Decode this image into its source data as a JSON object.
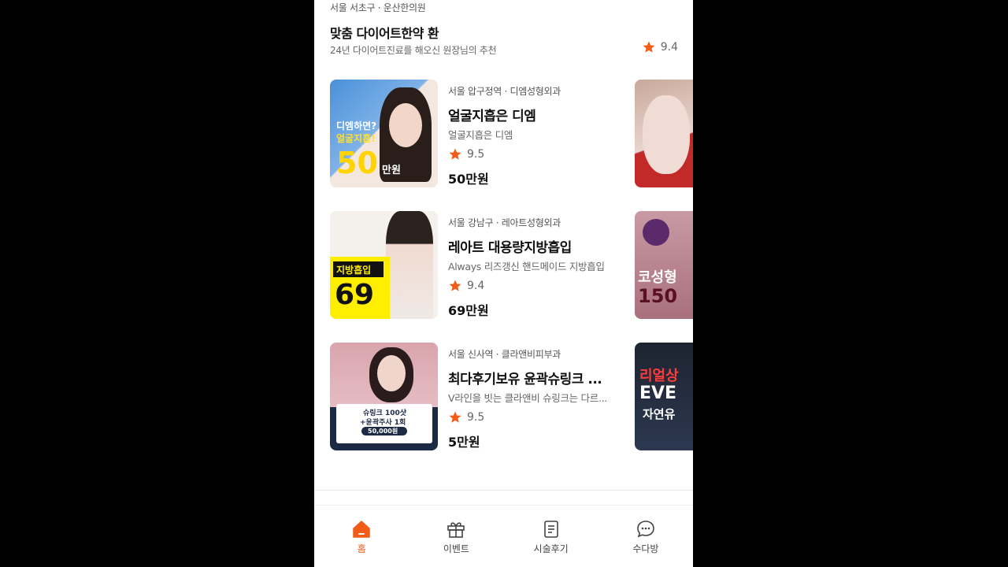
{
  "colors": {
    "accent": "#f25c19",
    "star": "#f25c19"
  },
  "top_card": {
    "location": "서울 서초구 · 운산한의원",
    "title": "맞춤 다이어트한약 환",
    "description": "24년 다이어트진료를 해오신 원장님의 추천",
    "rating": "9.4"
  },
  "items": [
    {
      "location": "서울 압구정역 · 디엠성형외과",
      "title": "얼굴지흡은 디엠",
      "description": "얼굴지흡은 디엠",
      "rating": "9.5",
      "price": "50만원",
      "thumb_text_1": "디엠하면?",
      "thumb_text_2": "얼굴지흡!",
      "thumb_text_3": "50",
      "thumb_text_4": "만원"
    },
    {
      "location": "서울 강남구 · 레아트성형외과",
      "title": "레아트 대용량지방흡입",
      "description": "Always 리즈갱신 핸드메이드 지방흡입",
      "rating": "9.4",
      "price": "69만원",
      "thumb_text_1": "지방흡입",
      "thumb_text_2": "69"
    },
    {
      "location": "서울 신사역 · 클라앤비피부과",
      "title": "최다후기보유 윤곽슈링크 ...",
      "description": "V라인을 빗는 클라앤비 슈링크는 다르...",
      "rating": "9.5",
      "price": "5만원",
      "thumb_text_1": "슈링크 100샷",
      "thumb_text_2": "+윤곽주사 1회",
      "thumb_text_3": "50,000원"
    }
  ],
  "peeks": [
    {
      "text": ""
    },
    {
      "text_1": "코성형",
      "text_2": "150"
    },
    {
      "text_1": "리얼상",
      "text_2": "EVE",
      "text_3": "자연유"
    }
  ],
  "tabs": [
    {
      "label": "홈",
      "icon": "home-icon"
    },
    {
      "label": "이벤트",
      "icon": "gift-icon"
    },
    {
      "label": "시술후기",
      "icon": "review-icon"
    },
    {
      "label": "수다방",
      "icon": "chat-icon"
    }
  ]
}
